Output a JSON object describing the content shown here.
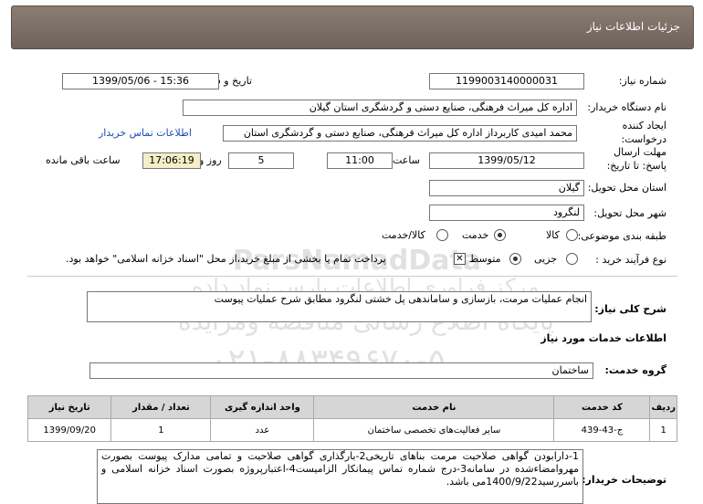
{
  "header": {
    "title": "جزئیات اطلاعات نیاز"
  },
  "fields": {
    "need_number_label": "شماره نیاز:",
    "need_number": "1199003140000031",
    "announce_label": "تاریخ و ساعت اعلان عمومی:",
    "announce_value": "1399/05/06 - 15:36",
    "buyer_label": "نام دستگاه خریدار:",
    "buyer_value": "اداره کل میراث فرهنگی، صنایع دستی و گردشگری استان گیلان",
    "creator_label": "ایجاد کننده درخواست:",
    "creator_value": "محمد امیدی کاربرداز اداره کل میراث فرهنگی، صنایع دستی و گردشگری استان",
    "contact_link": "اطلاعات تماس خریدار",
    "deadline_label": "مهلت ارسال پاسخ: تا تاریخ:",
    "deadline_date": "1399/05/12",
    "time_label": "ساعت",
    "deadline_time": "11:00",
    "days_value": "5",
    "days_label": "روز و",
    "remaining_time": "17:06:19",
    "remaining_label": "ساعت باقی مانده",
    "province_label": "استان محل تحویل:",
    "province_value": "گیلان",
    "city_label": "شهر محل تحویل:",
    "city_value": "لنگرود",
    "category_label": "طبقه بندی موضوعی:",
    "category_options": [
      "کالا",
      "خدمت",
      "کالا/خدمت"
    ],
    "process_label": "نوع فرآیند خرید :",
    "process_options": [
      "جزیی",
      "متوسط"
    ],
    "payment_note": "پرداخت تمام یا بخشی از مبلغ خرید،از محل \"اسناد خزانه اسلامی\" خواهد بود."
  },
  "summary": {
    "label": "شرح کلی نیاز:",
    "value": "انجام عملیات مرمت، بازسازی و ساماندهی پل خشتی لنگرود مطابق شرح عملیات پیوست"
  },
  "services": {
    "section_title": "اطلاعات خدمات مورد نیاز",
    "group_label": "گروه خدمت:",
    "group_value": "ساختمان",
    "columns": [
      "ردیف",
      "کد خدمت",
      "نام خدمت",
      "واحد اندازه گیری",
      "تعداد / مقدار",
      "تاریخ نیاز"
    ],
    "rows": [
      [
        "1",
        "ج-43-439",
        "سایر فعالیت‌های تخصصی ساختمان",
        "عدد",
        "1",
        "1399/09/20"
      ]
    ]
  },
  "buyer_notes": {
    "label": "توضیحات خریدار:",
    "text": "1-دارابودن گواهی صلاحیت مرمت بناهای تاریخی2-بارگذاری گواهی صلاحیت و تمامی مدارک پیوست بصورت مهروامضاءشده در سامانه3-درج شماره تماس پیمانکار الزامیست4-اعتبارپروژه بصورت اسناد خزانه اسلامی و باسررسید1400/9/22می باشد."
  },
  "watermark": {
    "brand": "ParsNamadData",
    "line1": "مرکز فراوری اطلاعات پارس نماد داده",
    "line2": "پایگاه اطلاع رسانی مناقصه ومزایده",
    "phone": "۰۲۱-۸۸۳۴۹۶۷۰-۵"
  }
}
